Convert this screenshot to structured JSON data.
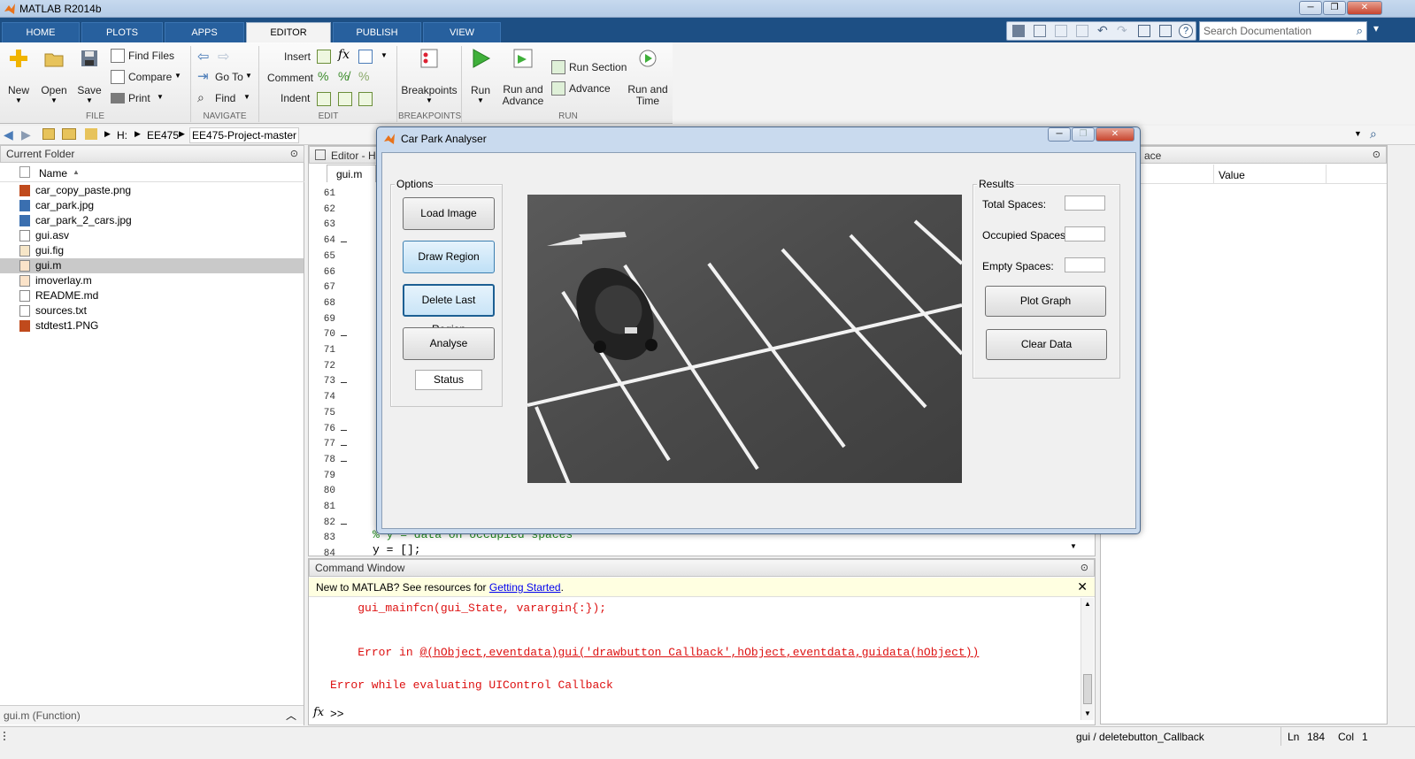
{
  "app": {
    "title": "MATLAB R2014b"
  },
  "tabs": [
    {
      "label": "HOME"
    },
    {
      "label": "PLOTS"
    },
    {
      "label": "APPS"
    },
    {
      "label": "EDITOR"
    },
    {
      "label": "PUBLISH"
    },
    {
      "label": "VIEW"
    }
  ],
  "search": {
    "placeholder": "Search Documentation"
  },
  "ribbon": {
    "new": "New",
    "open": "Open",
    "save": "Save",
    "find_files": "Find Files",
    "compare": "Compare",
    "print": "Print",
    "go_to": "Go To",
    "find": "Find",
    "insert": "Insert",
    "comment": "Comment",
    "indent": "Indent",
    "breakpoints": "Breakpoints",
    "run": "Run",
    "run_advance": "Run and Advance",
    "run_section": "Run Section",
    "advance": "Advance",
    "run_time": "Run and Time",
    "groups": {
      "file": "FILE",
      "navigate": "NAVIGATE",
      "edit": "EDIT",
      "breakpoints": "BREAKPOINTS",
      "run": "RUN"
    }
  },
  "address": {
    "drive": "H:",
    "folder1": "EE475",
    "folder2": "EE475-Project-master"
  },
  "current_folder": {
    "title": "Current Folder",
    "col_name": "Name",
    "files": [
      "car_copy_paste.png",
      "car_park.jpg",
      "car_park_2_cars.jpg",
      "gui.asv",
      "gui.fig",
      "gui.m",
      "imoverlay.m",
      "README.md",
      "sources.txt",
      "stdtest1.PNG"
    ],
    "selected": "gui.m",
    "details": "gui.m (Function)"
  },
  "editor": {
    "title": "Editor - H",
    "tab": "gui.m",
    "lines": [
      "61",
      "62",
      "63",
      "64",
      "65",
      "66",
      "67",
      "68",
      "69",
      "70",
      "71",
      "72",
      "73",
      "74",
      "75",
      "76",
      "77",
      "78",
      "79",
      "80",
      "81",
      "82",
      "83",
      "84"
    ],
    "visible_code_1": "% y = data on occupied spaces",
    "visible_code_2": "y = [];"
  },
  "workspace": {
    "title": "ace",
    "col_value": "Value"
  },
  "command_window": {
    "title": "Command Window",
    "banner_prefix": "New to MATLAB? See resources for ",
    "banner_link": "Getting Started",
    "banner_suffix": ".",
    "line1": "    gui_mainfcn(gui_State, varargin{:});",
    "error_prefix": "Error in ",
    "error_link": "@(hObject,eventdata)gui('drawbutton_Callback',hObject,eventdata,guidata(hObject))",
    "error2": "Error while evaluating UIControl Callback",
    "prompt": ">>"
  },
  "status": {
    "function": "gui / deletebutton_Callback",
    "ln_label": "Ln",
    "ln": "184",
    "col_label": "Col",
    "col": "1"
  },
  "dialog": {
    "title": "Car Park Analyser",
    "options_label": "Options",
    "load_image": "Load Image",
    "draw_region": "Draw Region",
    "delete_last_region": "Delete Last Region",
    "analyse": "Analyse",
    "status": "Status",
    "results_label": "Results",
    "total_spaces": "Total Spaces:",
    "occupied_spaces": "Occupied Spaces:",
    "empty_spaces": "Empty Spaces:",
    "total_value": "",
    "occupied_value": "",
    "empty_value": "",
    "plot_graph": "Plot Graph",
    "clear_data": "Clear Data"
  }
}
